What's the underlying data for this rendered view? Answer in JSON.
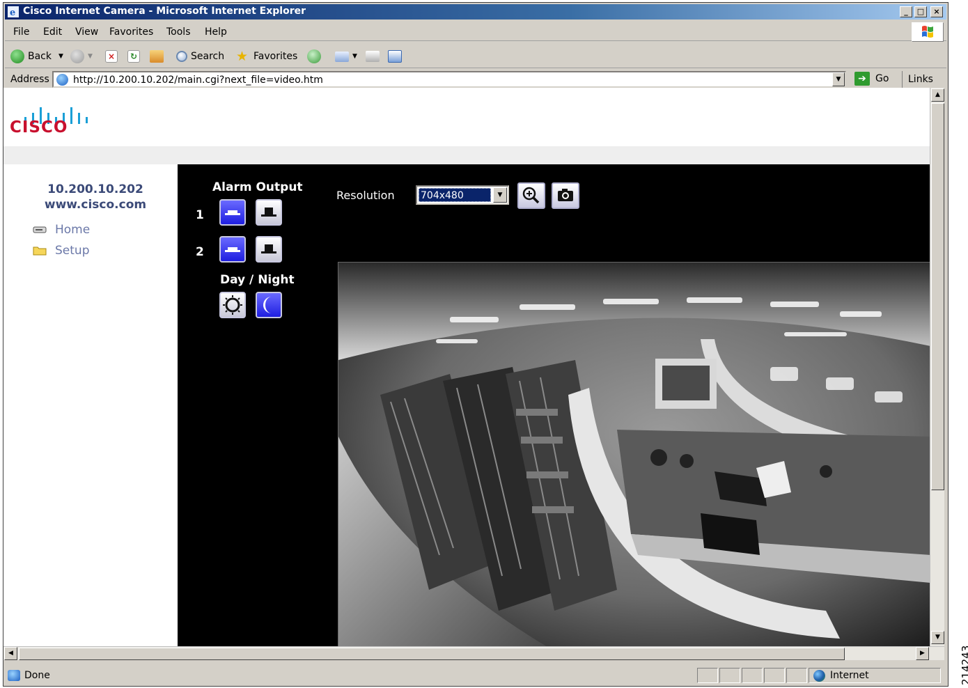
{
  "window": {
    "title": "Cisco Internet Camera - Microsoft Internet Explorer",
    "minimize": "_",
    "maximize": "□",
    "close": "×"
  },
  "menu": [
    "File",
    "Edit",
    "View",
    "Favorites",
    "Tools",
    "Help"
  ],
  "toolbar": {
    "back_label": "Back",
    "search_label": "Search",
    "favorites_label": "Favorites"
  },
  "address": {
    "label": "Address",
    "url": "http://10.200.10.202/main.cgi?next_file=video.htm",
    "go_label": "Go",
    "links_label": "Links"
  },
  "page": {
    "logo_text": "CISCO",
    "ip": "10.200.10.202",
    "site": "www.cisco.com",
    "nav": [
      {
        "label": "Home",
        "icon": "drive-icon"
      },
      {
        "label": "Setup",
        "icon": "folder-icon"
      }
    ],
    "alarm_output_label": "Alarm Output",
    "alarm_rows": [
      "1",
      "2"
    ],
    "day_night_label": "Day / Night",
    "resolution_label": "Resolution",
    "resolution_value": "704x480",
    "zoom_icon": "zoom-icon",
    "snapshot_icon": "camera-icon"
  },
  "status": {
    "text": "Done",
    "zone": "Internet"
  },
  "figure_id": "214243"
}
